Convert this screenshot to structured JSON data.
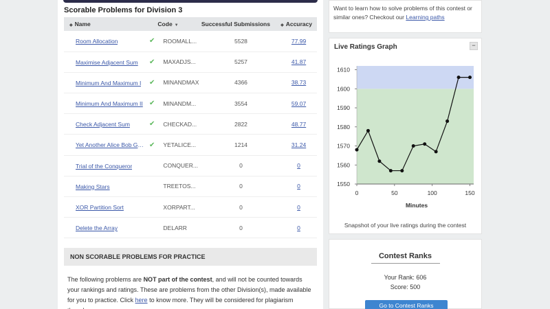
{
  "section_title": "Scorable Problems for Division 3",
  "table": {
    "headers": {
      "name": "Name",
      "code": "Code",
      "subs": "Successful Submissions",
      "acc": "Accuracy"
    },
    "rows": [
      {
        "name": "Room Allocation",
        "solved": true,
        "code": "ROOMALL...",
        "subs": "5528",
        "acc": "77.99"
      },
      {
        "name": "Maximise Adjacent Sum",
        "solved": true,
        "code": "MAXADJS...",
        "subs": "5257",
        "acc": "41.87"
      },
      {
        "name": "Minimum And Maximum I",
        "solved": true,
        "code": "MINANDMAX",
        "subs": "4366",
        "acc": "38.73"
      },
      {
        "name": "Minimum And Maximum II",
        "solved": true,
        "code": "MINANDM...",
        "subs": "3554",
        "acc": "59.07"
      },
      {
        "name": "Check Adjacent Sum",
        "solved": true,
        "code": "CHECKAD...",
        "subs": "2822",
        "acc": "48.77"
      },
      {
        "name": "Yet Another Alice Bob Ga...",
        "solved": true,
        "code": "YETALICE...",
        "subs": "1214",
        "acc": "31.24"
      },
      {
        "name": "Trial of the Conqueror",
        "solved": false,
        "code": "CONQUER...",
        "subs": "0",
        "acc": "0"
      },
      {
        "name": "Making Stars",
        "solved": false,
        "code": "TREETOS...",
        "subs": "0",
        "acc": "0"
      },
      {
        "name": "XOR Partition Sort",
        "solved": false,
        "code": "XORPART...",
        "subs": "0",
        "acc": "0"
      },
      {
        "name": "Delete the Array",
        "solved": false,
        "code": "DELARR",
        "subs": "0",
        "acc": "0"
      }
    ]
  },
  "nonscorable": {
    "header": "NON SCORABLE PROBLEMS FOR PRACTICE",
    "text_pre": "The following problems are ",
    "text_bold": "NOT part of the contest",
    "text_mid": ", and will not be counted towards your rankings and ratings. These are problems from the other Division(s), made available for you to practice. Click ",
    "link": "here",
    "text_post": " to know more. They will be considered for plagiarism though."
  },
  "learn": {
    "text": "Want to learn how to solve problems of this contest or similar ones? Checkout our ",
    "link": "Learning paths"
  },
  "graph": {
    "title": "Live Ratings Graph",
    "collapse": "−",
    "caption": "Snapshot of your live ratings during the contest"
  },
  "ranks": {
    "title": "Contest Ranks",
    "rank": "Your Rank: 606",
    "score": "Score: 500",
    "button": "Go to Contest Ranks"
  },
  "colors": {
    "link": "#3a57a8",
    "check": "#5cb85c",
    "green_zone": "#cfe6cd",
    "blue_zone": "#cdd8f3",
    "button": "#3e85d0"
  },
  "chart_data": {
    "type": "line",
    "title": "",
    "xlabel": "Minutes",
    "ylabel": "",
    "xlim": [
      0,
      155
    ],
    "ylim": [
      1550,
      1612
    ],
    "xticks": [
      0,
      50,
      100,
      150
    ],
    "yticks": [
      1550,
      1560,
      1570,
      1580,
      1590,
      1600,
      1610
    ],
    "bands": [
      {
        "from": 1550,
        "to": 1600,
        "color": "#cfe6cd"
      },
      {
        "from": 1600,
        "to": 1612,
        "color": "#cdd8f3"
      }
    ],
    "series": [
      {
        "x": [
          0,
          15,
          30,
          45,
          60,
          75,
          90,
          105,
          120,
          135,
          150
        ],
        "y": [
          1568,
          1578,
          1562,
          1557,
          1557,
          1570,
          1571,
          1567,
          1583,
          1606,
          1606
        ]
      }
    ]
  }
}
